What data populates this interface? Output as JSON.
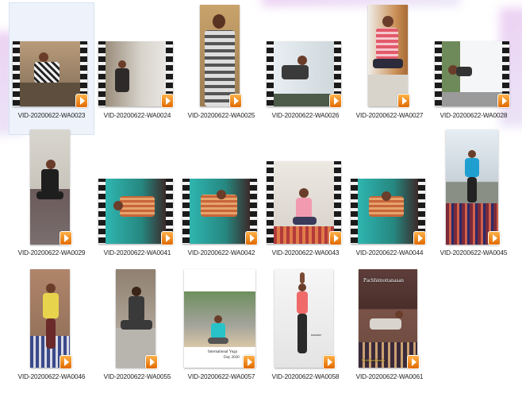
{
  "files": [
    "VID-20200622-WA0023",
    "VID-20200622-WA0024",
    "VID-20200622-WA0025",
    "VID-20200622-WA0026",
    "VID-20200622-WA0027",
    "VID-20200622-WA0028",
    "VID-20200622-WA0029",
    "VID-20200622-WA0041",
    "VID-20200622-WA0042",
    "VID-20200622-WA0043",
    "VID-20200622-WA0044",
    "VID-20200622-WA0045",
    "VID-20200622-WA0046",
    "VID-20200622-WA0055",
    "VID-20200622-WA0057",
    "VID-20200622-WA0058",
    "VID-20200622-WA0061"
  ],
  "selected_index": 0,
  "thumb_text": {
    "wa0057_caption_1": "International Yoga",
    "wa0057_caption_2": "Day 2020",
    "wa0058_caption": "namaste",
    "wa0061_title": "Pachhimottanasan",
    "wa0061_footer": "Pachhimottanasan"
  },
  "colors": {
    "selection": "#eef3fb",
    "play_icon": "#f08a10",
    "label_text": "#222222"
  }
}
